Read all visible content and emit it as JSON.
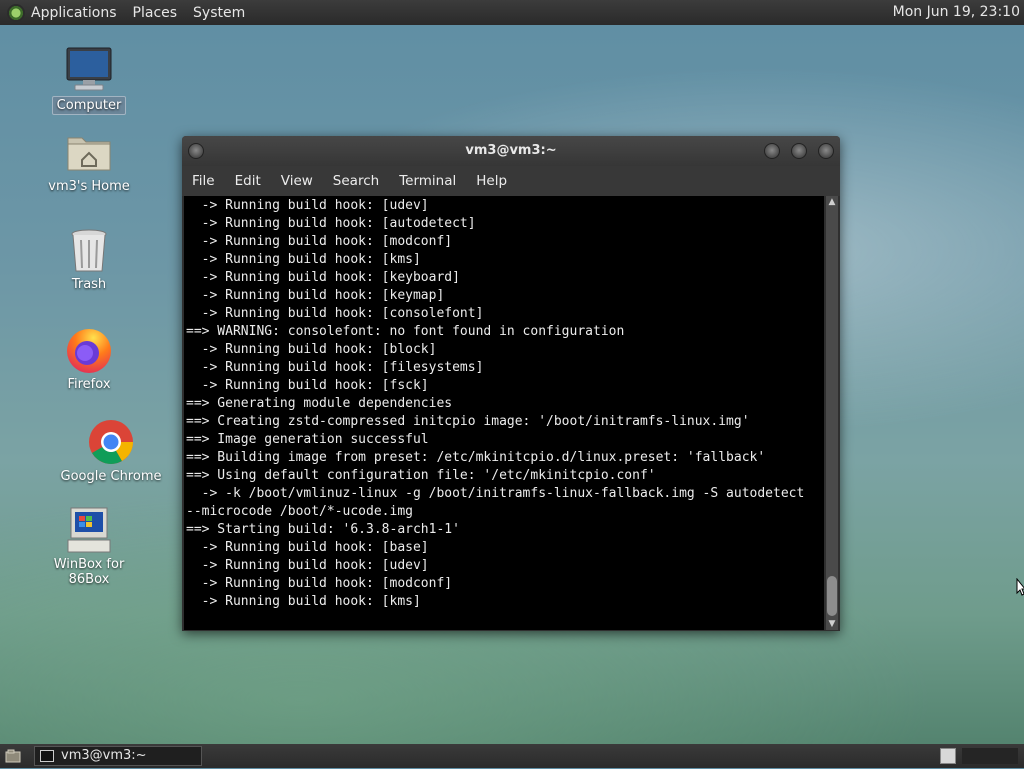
{
  "top_panel": {
    "menus": [
      "Applications",
      "Places",
      "System"
    ],
    "clock": "Mon Jun 19, 23:10"
  },
  "desktop": {
    "icons": [
      {
        "label": "Computer",
        "icon": "computer-icon"
      },
      {
        "label": "vm3's Home",
        "icon": "home-folder-icon"
      },
      {
        "label": "Trash",
        "icon": "trash-icon"
      },
      {
        "label": "Firefox",
        "icon": "firefox-icon"
      },
      {
        "label": "Google Chrome",
        "icon": "chrome-icon"
      },
      {
        "label": "WinBox for 86Box",
        "icon": "winbox-icon"
      }
    ]
  },
  "terminal": {
    "title": "vm3@vm3:~",
    "menu": [
      "File",
      "Edit",
      "View",
      "Search",
      "Terminal",
      "Help"
    ],
    "lines": [
      "  -> Running build hook: [udev]",
      "  -> Running build hook: [autodetect]",
      "  -> Running build hook: [modconf]",
      "  -> Running build hook: [kms]",
      "  -> Running build hook: [keyboard]",
      "  -> Running build hook: [keymap]",
      "  -> Running build hook: [consolefont]",
      "==> WARNING: consolefont: no font found in configuration",
      "  -> Running build hook: [block]",
      "  -> Running build hook: [filesystems]",
      "  -> Running build hook: [fsck]",
      "==> Generating module dependencies",
      "==> Creating zstd-compressed initcpio image: '/boot/initramfs-linux.img'",
      "==> Image generation successful",
      "==> Building image from preset: /etc/mkinitcpio.d/linux.preset: 'fallback'",
      "==> Using default configuration file: '/etc/mkinitcpio.conf'",
      "  -> -k /boot/vmlinuz-linux -g /boot/initramfs-linux-fallback.img -S autodetect",
      "--microcode /boot/*-ucode.img",
      "==> Starting build: '6.3.8-arch1-1'",
      "  -> Running build hook: [base]",
      "  -> Running build hook: [udev]",
      "  -> Running build hook: [modconf]",
      "  -> Running build hook: [kms]"
    ]
  },
  "taskbar": {
    "task_label": "vm3@vm3:~"
  }
}
